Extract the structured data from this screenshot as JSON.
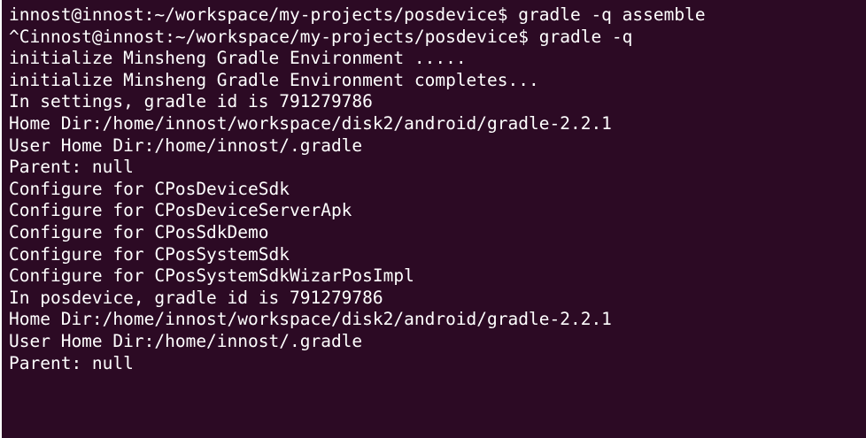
{
  "terminal": {
    "lines": [
      "innost@innost:~/workspace/my-projects/posdevice$ gradle -q assemble",
      "^Cinnost@innost:~/workspace/my-projects/posdevice$ gradle -q",
      "initialize Minsheng Gradle Environment .....",
      "initialize Minsheng Gradle Environment completes...",
      "In settings, gradle id is 791279786",
      "Home Dir:/home/innost/workspace/disk2/android/gradle-2.2.1",
      "User Home Dir:/home/innost/.gradle",
      "Parent: null",
      "Configure for CPosDeviceSdk",
      "Configure for CPosDeviceServerApk",
      "Configure for CPosSdkDemo",
      "Configure for CPosSystemSdk",
      "Configure for CPosSystemSdkWizarPosImpl",
      "In posdevice, gradle id is 791279786",
      "Home Dir:/home/innost/workspace/disk2/android/gradle-2.2.1",
      "User Home Dir:/home/innost/.gradle",
      "Parent: null"
    ]
  },
  "colors": {
    "background": "#2c0a24",
    "foreground": "#ffffff"
  }
}
